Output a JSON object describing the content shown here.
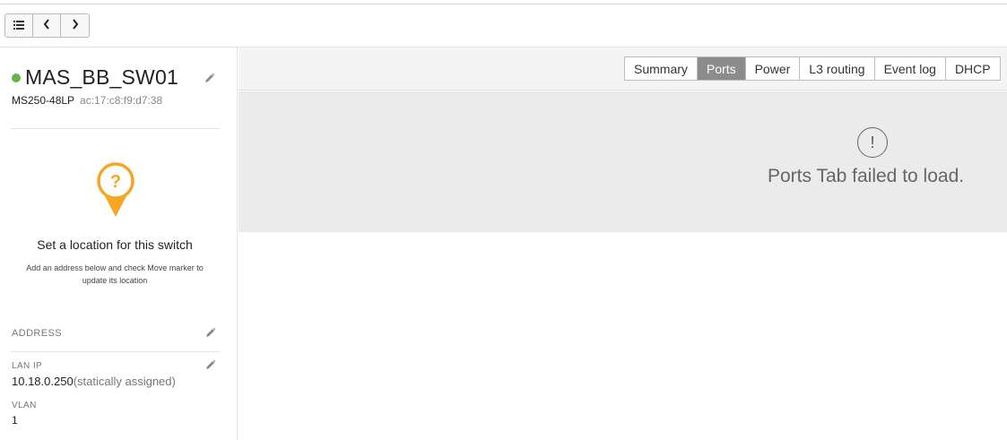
{
  "toolbar": {
    "list_icon": "list-icon",
    "prev_icon": "chevron-left-icon",
    "next_icon": "chevron-right-icon"
  },
  "device": {
    "name": "MAS_BB_SW01",
    "status_color": "#67b346",
    "model": "MS250-48LP",
    "mac": "ac:17:c8:f9:d7:38"
  },
  "location": {
    "title": "Set a location for this switch",
    "help": "Add an address below and check Move marker to update its location",
    "pin_color": "#f5a623"
  },
  "address": {
    "label": "ADDRESS"
  },
  "lan_ip": {
    "label": "LAN IP",
    "value": "10.18.0.250",
    "note": "(statically assigned)"
  },
  "vlan": {
    "label": "VLAN",
    "value": "1"
  },
  "tabs": [
    {
      "label": "Summary",
      "active": false
    },
    {
      "label": "Ports",
      "active": true
    },
    {
      "label": "Power",
      "active": false
    },
    {
      "label": "L3 routing",
      "active": false
    },
    {
      "label": "Event log",
      "active": false
    },
    {
      "label": "DHCP",
      "active": false
    }
  ],
  "error": {
    "icon_glyph": "!",
    "message": "Ports Tab failed to load."
  }
}
